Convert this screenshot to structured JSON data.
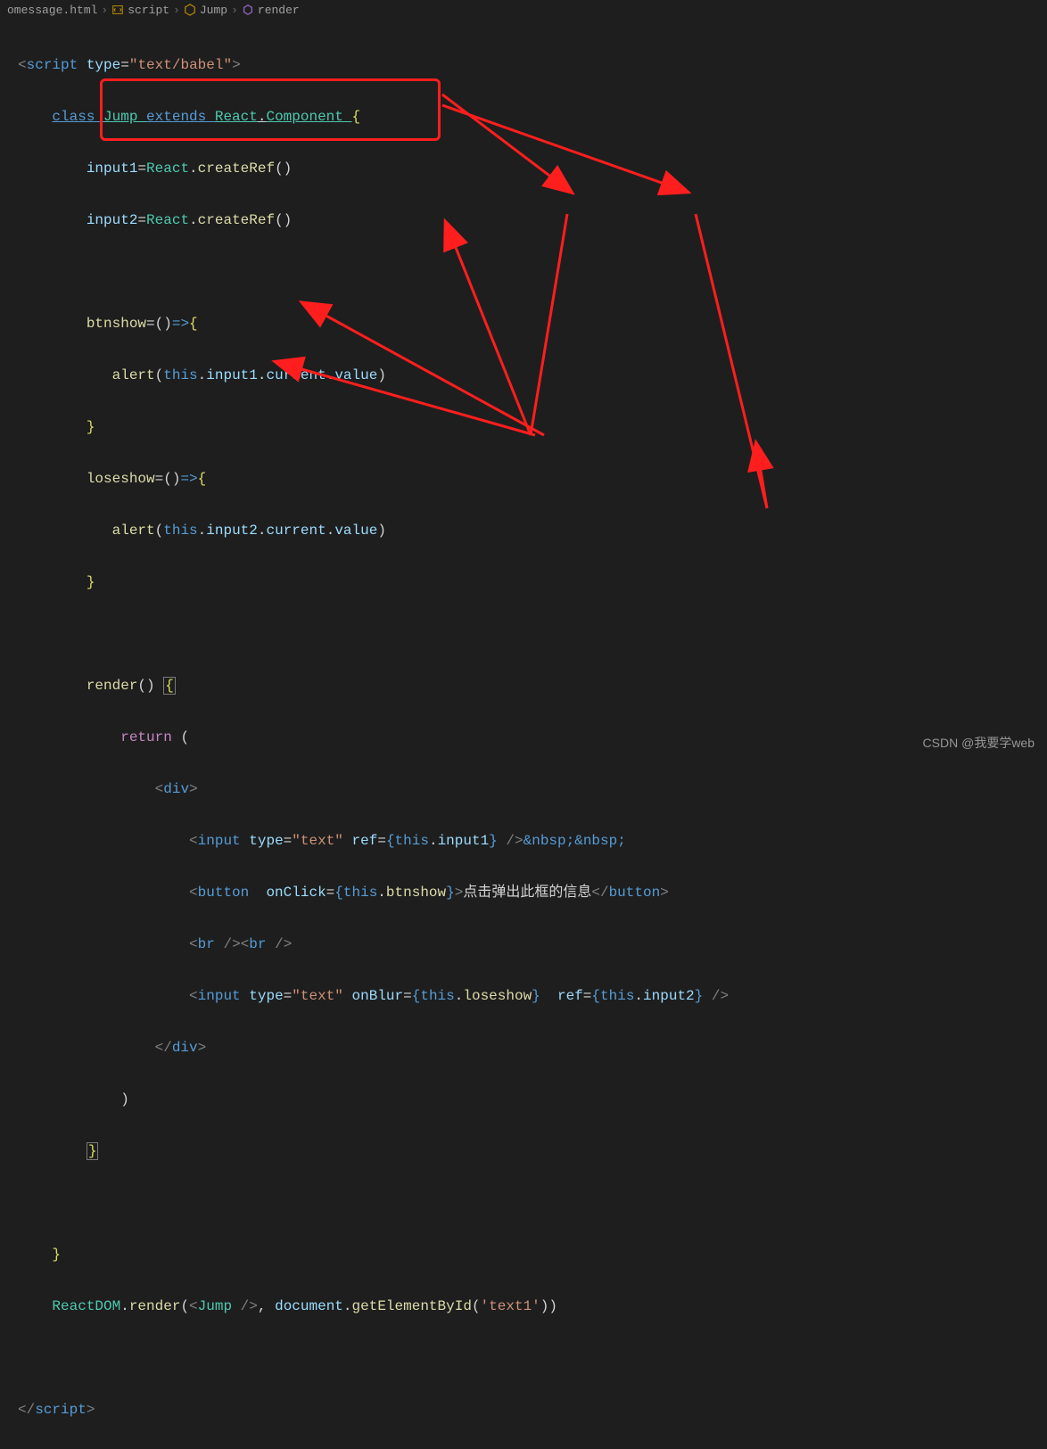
{
  "breadcrumb": {
    "file": "omessage.html",
    "item1": "script",
    "item2": "Jump",
    "item3": "render"
  },
  "code": {
    "line1": {
      "open": "<",
      "tag": "script",
      "sp": " ",
      "attr": "type",
      "eq": "=",
      "q": "\"",
      "val": "text/babel",
      "q2": "\"",
      "close": ">"
    },
    "line2": {
      "indent": "    ",
      "kw1": "class ",
      "cls": "Jump ",
      "kw2": "extends ",
      "sup": "React",
      "dot": ".",
      "comp": "Component ",
      "brace": "{"
    },
    "line3": {
      "indent": "        ",
      "prop": "input1",
      "eq": "=",
      "obj": "React",
      "dot": ".",
      "fn": "createRef",
      "p": "()"
    },
    "line4": {
      "indent": "        ",
      "prop": "input2",
      "eq": "=",
      "obj": "React",
      "dot": ".",
      "fn": "createRef",
      "p": "()"
    },
    "line6": {
      "indent": "        ",
      "fn": "btnshow",
      "eq": "=",
      "arrow": "()",
      "fat": "=>",
      "brace": "{"
    },
    "line7": {
      "indent": "           ",
      "fn": "alert",
      "p1": "(",
      "this": "this",
      "d1": ".",
      "a1": "input1",
      "d2": ".",
      "a2": "current",
      "d3": ".",
      "a3": "value",
      "p2": ")"
    },
    "line8": {
      "indent": "        ",
      "brace": "}"
    },
    "line9": {
      "indent": "        ",
      "fn": "loseshow",
      "eq": "=",
      "arrow": "()",
      "fat": "=>",
      "brace": "{"
    },
    "line10": {
      "indent": "           ",
      "fn": "alert",
      "p1": "(",
      "this": "this",
      "d1": ".",
      "a1": "input2",
      "d2": ".",
      "a2": "current",
      "d3": ".",
      "a3": "value",
      "p2": ")"
    },
    "line11": {
      "indent": "        ",
      "brace": "}"
    },
    "line13": {
      "indent": "        ",
      "fn": "render",
      "p": "() ",
      "brace": "{"
    },
    "line14": {
      "indent": "            ",
      "kw": "return ",
      "p": "("
    },
    "line15": {
      "indent": "                ",
      "lt": "<",
      "tag": "div",
      "gt": ">"
    },
    "line16": {
      "indent": "                    ",
      "lt": "<",
      "tag": "input",
      "sp": " ",
      "a1": "type",
      "eq": "=",
      "q": "\"",
      "v1": "text",
      "q2": "\"",
      "sp2": " ",
      "a2": "ref",
      "eq2": "=",
      "b1": "{",
      "this": "this",
      "d": ".",
      "prop": "input1",
      "b2": "}",
      "sp3": " ",
      "slash": "/",
      "gt": ">",
      "e1": "&nbsp;",
      "e2": "&nbsp;"
    },
    "line17": {
      "indent": "                    ",
      "lt": "<",
      "tag": "button",
      "sp": "  ",
      "a1": "onClick",
      "eq": "=",
      "b1": "{",
      "this": "this",
      "d": ".",
      "fn": "btnshow",
      "b2": "}",
      "gt": ">",
      "txt": "点击弹出此框的信息",
      "lt2": "</",
      "tag2": "button",
      "gt2": ">"
    },
    "line18": {
      "indent": "                    ",
      "lt": "<",
      "tag": "br",
      "sp": " ",
      "slash": "/",
      "gt": ">",
      "lt2": "<",
      "tag2": "br",
      "sp2": " ",
      "slash2": "/",
      "gt2": ">"
    },
    "line19": {
      "indent": "                    ",
      "lt": "<",
      "tag": "input",
      "sp": " ",
      "a1": "type",
      "eq": "=",
      "q": "\"",
      "v1": "text",
      "q2": "\"",
      "sp2": " ",
      "a2": "onBlur",
      "eq2": "=",
      "b1": "{",
      "this": "this",
      "d": ".",
      "fn": "loseshow",
      "b2": "}",
      "sp3": "  ",
      "a3": "ref",
      "eq3": "=",
      "b3": "{",
      "this2": "this",
      "d2": ".",
      "prop": "input2",
      "b4": "}",
      "sp4": " ",
      "slash": "/",
      "gt": ">"
    },
    "line20": {
      "indent": "                ",
      "lt": "</",
      "tag": "div",
      "gt": ">"
    },
    "line21": {
      "indent": "            ",
      "p": ")"
    },
    "line22": {
      "indent": "        ",
      "brace": "}"
    },
    "line24": {
      "indent": "    ",
      "brace": "}"
    },
    "line25": {
      "indent": "    ",
      "obj": "ReactDOM",
      "d": ".",
      "fn": "render",
      "p1": "(",
      "lt": "<",
      "tag": "Jump",
      "sp": " ",
      "slash": "/",
      "gt": ">",
      "c": ", ",
      "doc": "document",
      "d2": ".",
      "fn2": "getElementById",
      "p2": "(",
      "q": "'",
      "str": "text1",
      "q2": "'",
      "p3": ")",
      "p4": ")"
    },
    "line27": {
      "lt": "</",
      "tag": "script",
      "gt": ">"
    }
  },
  "watermark": "CSDN @我要学web"
}
